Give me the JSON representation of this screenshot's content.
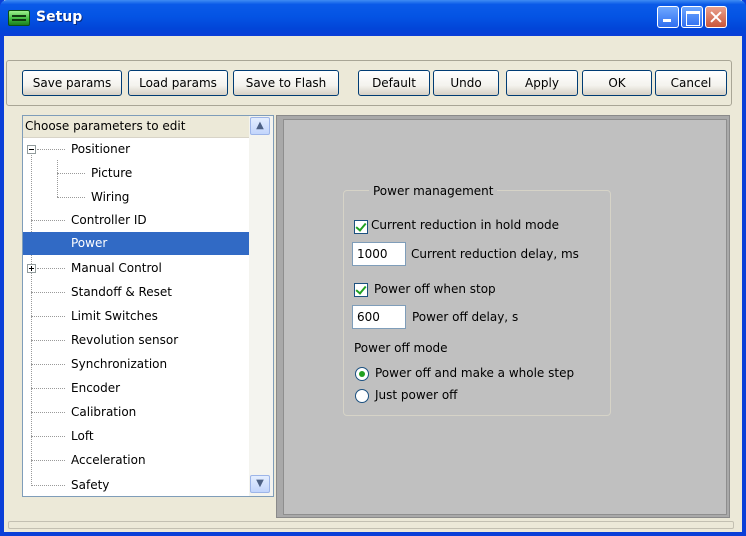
{
  "window": {
    "title": "Setup"
  },
  "toolbar": {
    "save_params": "Save params",
    "load_params": "Load params",
    "save_to_flash": "Save to Flash",
    "default": "Default",
    "undo": "Undo",
    "apply": "Apply",
    "ok": "OK",
    "cancel": "Cancel"
  },
  "tree": {
    "header": "Choose parameters to edit",
    "selected": "Power",
    "items": [
      "Positioner",
      "Picture",
      "Wiring",
      "Controller ID",
      "Power",
      "Manual Control",
      "Standoff & Reset",
      "Limit Switches",
      "Revolution sensor",
      "Synchronization",
      "Encoder",
      "Calibration",
      "Loft",
      "Acceleration",
      "Safety"
    ]
  },
  "power": {
    "group_title": "Power management",
    "current_reduction_label": "Current reduction in hold mode",
    "current_reduction_checked": true,
    "reduction_delay_value": "1000",
    "reduction_delay_label": "Current reduction delay, ms",
    "power_off_label": "Power off when stop",
    "power_off_checked": true,
    "power_off_delay_value": "600",
    "power_off_delay_label": "Power off delay, s",
    "mode_label": "Power off mode",
    "mode_options": [
      "Power off and make a whole step",
      "Just power off"
    ],
    "mode_selected": "Power off and make a whole step"
  },
  "colors": {
    "title_bar": "#0454e4",
    "selection": "#316ac5",
    "check": "#21a121"
  }
}
